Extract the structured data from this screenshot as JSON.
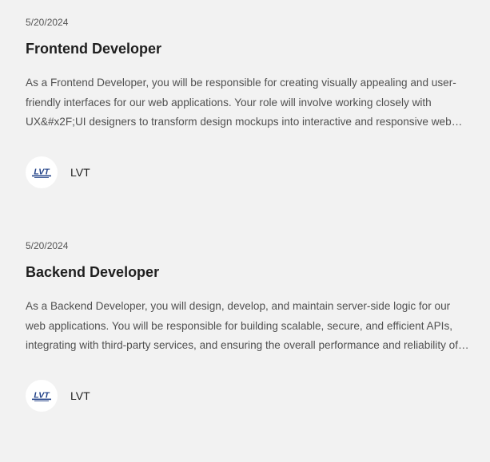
{
  "jobs": [
    {
      "date": "5/20/2024",
      "title": "Frontend Developer",
      "description": "As a Frontend Developer, you will be responsible for creating visually appealing and user-friendly interfaces for our web applications. Your role will involve working closely with UX&#x2F;UI designers to transform design mockups into interactive and responsive web applications.",
      "company": {
        "name": "LVT",
        "logo_icon": "lvt-logo-icon",
        "logo_color": "#1f3f86"
      }
    },
    {
      "date": "5/20/2024",
      "title": "Backend Developer",
      "description": "As a Backend Developer, you will design, develop, and maintain server-side logic for our web applications. You will be responsible for building scalable, secure, and efficient APIs, integrating with third-party services, and ensuring the overall performance and reliability of our systems.",
      "company": {
        "name": "LVT",
        "logo_icon": "lvt-logo-icon",
        "logo_color": "#1f3f86"
      }
    }
  ]
}
